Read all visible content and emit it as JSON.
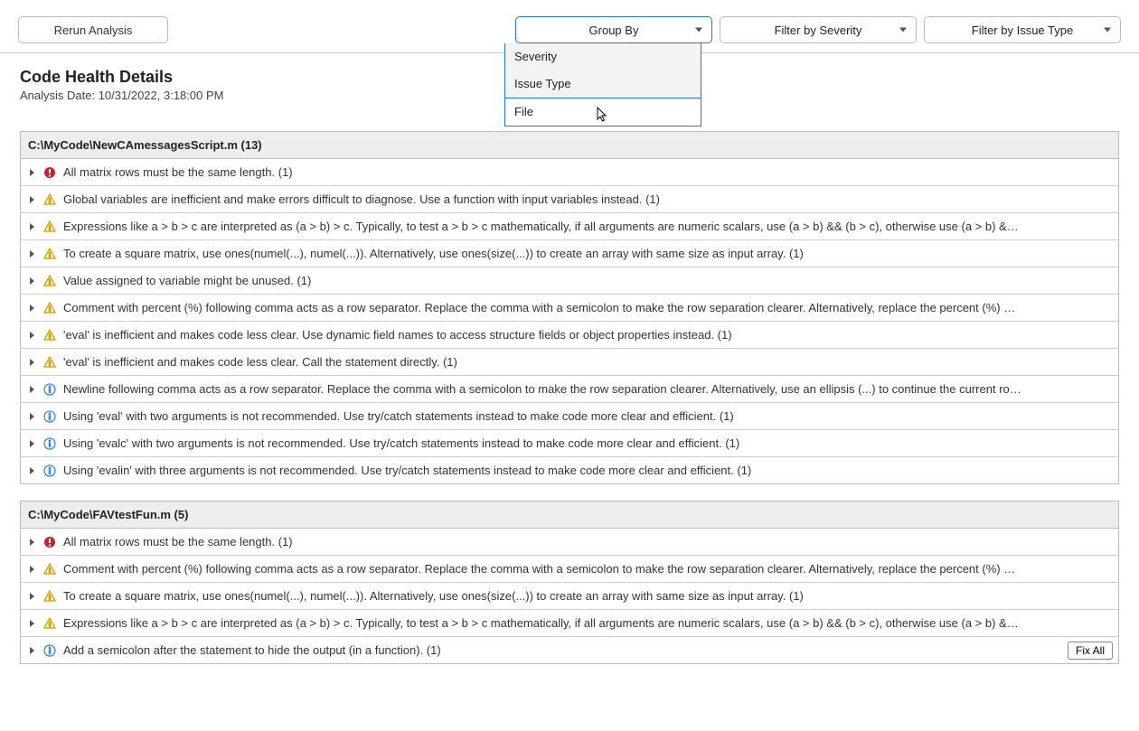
{
  "toolbar": {
    "rerun_label": "Rerun Analysis",
    "group_by_label": "Group By",
    "filter_severity_label": "Filter by Severity",
    "filter_issue_type_label": "Filter by Issue Type"
  },
  "group_by_menu": {
    "option_severity": "Severity",
    "option_issue_type": "Issue Type",
    "option_file": "File"
  },
  "header": {
    "title": "Code Health Details",
    "analysis_date": "Analysis Date: 10/31/2022, 3:18:00 PM"
  },
  "groups": [
    {
      "header": "C:\\MyCode\\NewCAmessagesScript.m (13)",
      "issues": [
        {
          "severity": "error",
          "text": "All matrix rows must be the same length. (1)"
        },
        {
          "severity": "warning",
          "text": "Global variables are inefficient and make errors difficult to diagnose. Use a function with input variables instead. (1)"
        },
        {
          "severity": "warning",
          "text": "Expressions like a > b > c are interpreted as (a > b) > c. Typically, to test a > b > c mathematically, if all arguments are numeric scalars, use (a > b) && (b > c), otherwise use (a > b) &…"
        },
        {
          "severity": "warning",
          "text": "To create a square matrix, use ones(numel(...), numel(...)). Alternatively, use ones(size(...)) to create an array with same size as input array. (1)"
        },
        {
          "severity": "warning",
          "text": "Value assigned to variable might be unused. (1)"
        },
        {
          "severity": "warning",
          "text": "Comment with percent (%) following comma acts as a row separator. Replace the comma with a semicolon to make the row separation clearer. Alternatively, replace the percent (%) …"
        },
        {
          "severity": "warning",
          "text": "'eval' is inefficient and makes code less clear. Use dynamic field names to access structure fields or object properties instead. (1)"
        },
        {
          "severity": "warning",
          "text": "'eval' is inefficient and makes code less clear. Call the statement directly. (1)"
        },
        {
          "severity": "info",
          "text": "Newline following comma acts as a row separator. Replace the comma with a semicolon to make the row separation clearer. Alternatively, use an ellipsis (...) to continue the current ro…"
        },
        {
          "severity": "info",
          "text": "Using 'eval' with two arguments is not recommended. Use try/catch statements instead to make code more clear and efficient. (1)"
        },
        {
          "severity": "info",
          "text": "Using 'evalc' with two arguments is not recommended. Use try/catch statements instead to make code more clear and efficient. (1)"
        },
        {
          "severity": "info",
          "text": "Using 'evalin' with three arguments is not recommended. Use try/catch statements instead to make code more clear and efficient. (1)"
        }
      ]
    },
    {
      "header": "C:\\MyCode\\FAVtestFun.m (5)",
      "issues": [
        {
          "severity": "error",
          "text": "All matrix rows must be the same length. (1)"
        },
        {
          "severity": "warning",
          "text": "Comment with percent (%) following comma acts as a row separator. Replace the comma with a semicolon to make the row separation clearer. Alternatively, replace the percent (%) …"
        },
        {
          "severity": "warning",
          "text": "To create a square matrix, use ones(numel(...), numel(...)). Alternatively, use ones(size(...)) to create an array with same size as input array. (1)"
        },
        {
          "severity": "warning",
          "text": "Expressions like a > b > c are interpreted as (a > b) > c. Typically, to test a > b > c mathematically, if all arguments are numeric scalars, use (a > b) && (b > c), otherwise use (a > b) &…"
        },
        {
          "severity": "info",
          "text": "Add a semicolon after the statement to hide the output (in a function). (1)",
          "fixAll": true
        }
      ]
    }
  ],
  "fix_all_label": "Fix All"
}
